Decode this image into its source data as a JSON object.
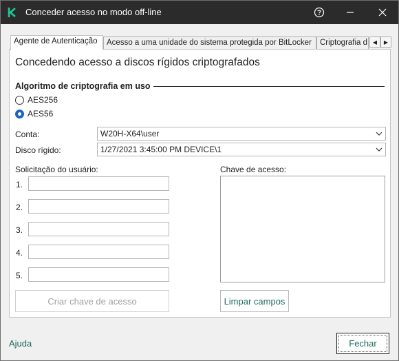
{
  "window": {
    "title": "Conceder acesso no modo off-line",
    "accent_color": "#1e6b5c",
    "help_icon": "help-circle-icon",
    "close_icon": "close-icon"
  },
  "tabs": [
    {
      "label": "Agente de Autenticação",
      "active": true
    },
    {
      "label": "Acesso a uma unidade do sistema protegida por BitLocker",
      "active": false
    },
    {
      "label": "Criptografia d",
      "active": false
    }
  ],
  "heading": "Concedendo acesso a discos rígidos criptografados",
  "algorithm": {
    "title": "Algoritmo de criptografia em uso",
    "options": [
      {
        "label": "AES256",
        "selected": false
      },
      {
        "label": "AES56",
        "selected": true
      }
    ]
  },
  "fields": {
    "account_label": "Conta:",
    "account_value": "W20H-X64\\user",
    "disk_label": "Disco rígido:",
    "disk_value": "1/27/2021 3:45:00 PM  DEVICE\\1"
  },
  "request": {
    "label": "Solicitação do usuário:",
    "numbers": [
      "1.",
      "2.",
      "3.",
      "4.",
      "5."
    ]
  },
  "access_key": {
    "label": "Chave de acesso:"
  },
  "buttons": {
    "create_key": "Criar chave de acesso",
    "clear_fields": "Limpar campos"
  },
  "footer": {
    "help": "Ajuda",
    "close": "Fechar"
  }
}
